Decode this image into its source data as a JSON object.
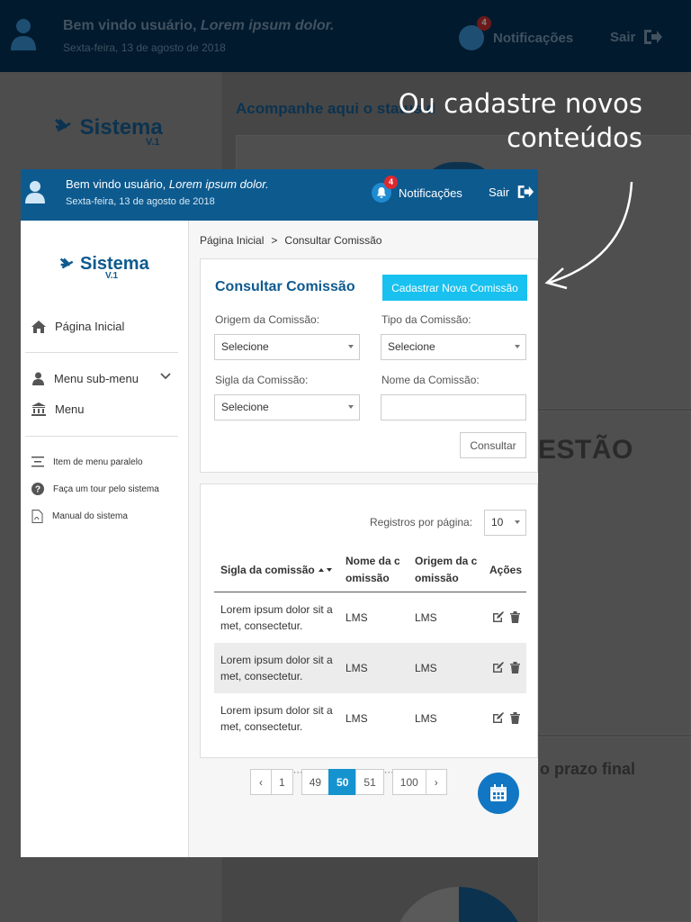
{
  "background_app": {
    "welcome_prefix": "Bem vindo usuário,",
    "welcome_name": "Lorem ipsum dolor.",
    "date": "Sexta-feira, 13 de agosto de 2018",
    "notifications_label": "Notificações",
    "notifications_count": "4",
    "exit_label": "Sair",
    "logo": "Sistema",
    "logo_version": "V.1",
    "status_heading": "Acompanhe aqui o status d",
    "gestao_heading": "ESTÃO",
    "prazo_heading": "o prazo final"
  },
  "annotation": {
    "line1": "Ou cadastre novos",
    "line2": "conteúdos"
  },
  "header": {
    "welcome_prefix": "Bem vindo usuário,",
    "welcome_name": "Lorem ipsum dolor.",
    "date": "Sexta-feira, 13 de agosto de 2018",
    "notifications_label": "Notificações",
    "notifications_count": "4",
    "exit_label": "Sair"
  },
  "sidebar": {
    "logo": "Sistema",
    "logo_version": "V.1",
    "items": [
      {
        "label": "Página Inicial",
        "icon": "home-icon"
      },
      {
        "label": "Menu sub-menu",
        "icon": "user-icon"
      },
      {
        "label": "Menu",
        "icon": "bank-icon"
      },
      {
        "label": "Item de menu paralelo",
        "icon": "list-icon"
      },
      {
        "label": "Faça um tour pelo sistema",
        "icon": "help-icon"
      },
      {
        "label": "Manual do sistema",
        "icon": "pdf-icon"
      }
    ]
  },
  "breadcrumb": {
    "home": "Página Inicial",
    "separator": ">",
    "current": "Consultar Comissão"
  },
  "form": {
    "title": "Consultar Comissão",
    "new_button": "Cadastrar Nova Comissão",
    "origin_label": "Origem da Comissão:",
    "origin_value": "Selecione",
    "type_label": "Tipo da Comissão:",
    "type_value": "Selecione",
    "acronym_label": "Sigla da Comissão:",
    "acronym_value": "Selecione",
    "name_label": "Nome da Comissão:",
    "name_value": "",
    "query_button": "Consultar"
  },
  "results": {
    "per_page_label": "Registros por página:",
    "per_page_value": "10",
    "columns": [
      "Sigla da comissão",
      "Nome da c omissão",
      "Origem da c omissão",
      "Ações"
    ],
    "rows": [
      {
        "sigla": "Lorem ipsum dolor sit a met, consectetur.",
        "nome": "LMS",
        "origem": "LMS"
      },
      {
        "sigla": "Lorem ipsum dolor sit a met, consectetur.",
        "nome": "LMS",
        "origem": "LMS"
      },
      {
        "sigla": "Lorem ipsum dolor sit a met, consectetur.",
        "nome": "LMS",
        "origem": "LMS"
      }
    ]
  },
  "pagination": {
    "prev": "‹",
    "pages": [
      "1",
      "49",
      "50",
      "51",
      "100"
    ],
    "ellipsis": "···",
    "current": "50",
    "next": "›"
  },
  "colors": {
    "header_blue": "#0d5a8f",
    "accent_cyan": "#18c1ef",
    "active_page": "#1593cf",
    "badge_red": "#e0282e"
  }
}
